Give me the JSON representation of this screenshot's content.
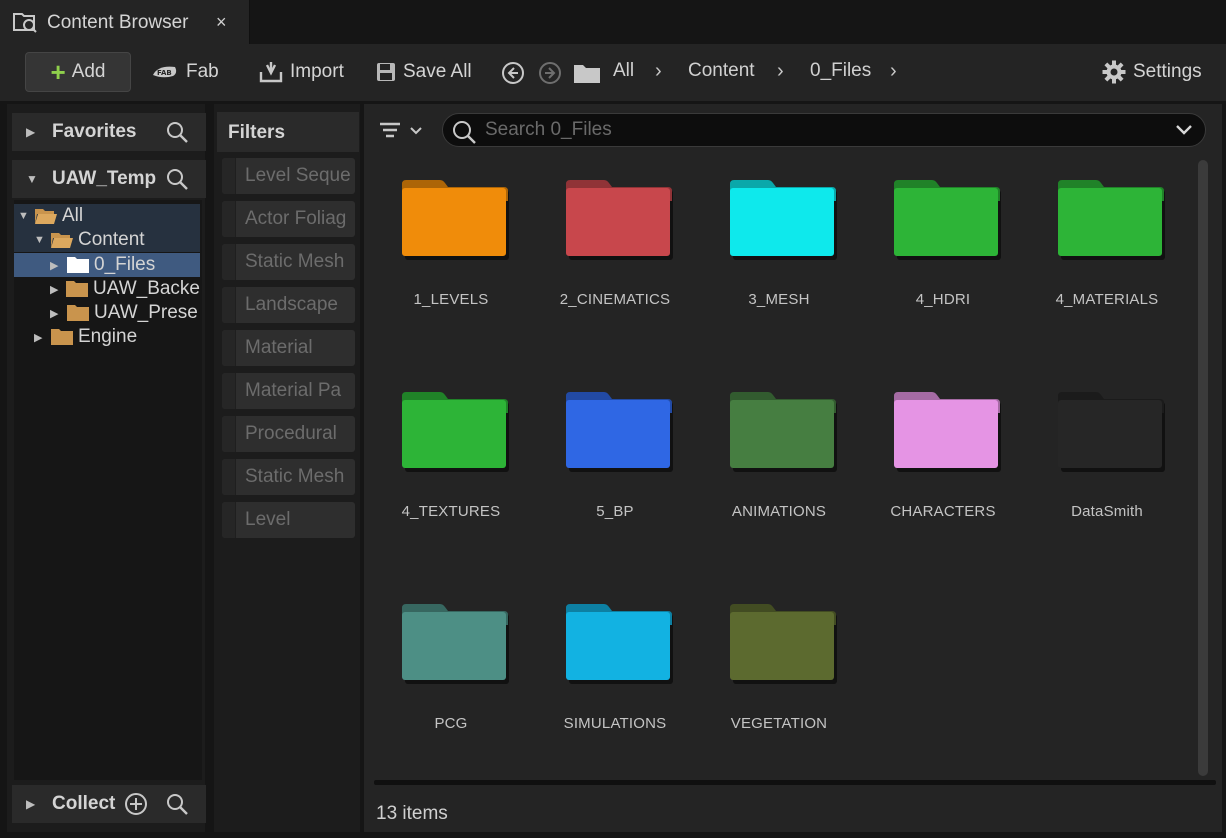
{
  "tab": {
    "title": "Content Browser",
    "close": "×"
  },
  "toolbar": {
    "add_label": "Add",
    "fab_label": "Fab",
    "import_label": "Import",
    "save_all_label": "Save All",
    "settings_label": "Settings"
  },
  "breadcrumbs": [
    "All",
    "Content",
    "0_Files"
  ],
  "left_panel": {
    "favorites_label": "Favorites",
    "project_label": "UAW_Temp",
    "collections_label": "Collect",
    "tree": [
      {
        "label": "All",
        "expanded": true
      },
      {
        "label": "Content",
        "expanded": true
      },
      {
        "label": "0_Files",
        "selected": true
      },
      {
        "label": "UAW_Backe"
      },
      {
        "label": "UAW_Prese"
      },
      {
        "label": "Engine"
      }
    ]
  },
  "filters": {
    "title": "Filters",
    "items": [
      "Level Seque",
      "Actor Foliag",
      "Static Mesh",
      "Landscape",
      "Material",
      "Material Pa",
      "Procedural",
      "Static Mesh",
      "Level"
    ]
  },
  "search": {
    "placeholder": "Search 0_Files",
    "value": ""
  },
  "folders": [
    {
      "name": "1_LEVELS",
      "color": "#f08c0a"
    },
    {
      "name": "2_CINEMATICS",
      "color": "#c8474c"
    },
    {
      "name": "3_MESH",
      "color": "#0ee9ec"
    },
    {
      "name": "4_HDRI",
      "color": "#2db437"
    },
    {
      "name": "4_MATERIALS",
      "color": "#2db437"
    },
    {
      "name": "4_TEXTURES",
      "color": "#2db437"
    },
    {
      "name": "5_BP",
      "color": "#2f67e4"
    },
    {
      "name": "ANIMATIONS",
      "color": "#467e41"
    },
    {
      "name": "CHARACTERS",
      "color": "#e594e4"
    },
    {
      "name": "DataSmith",
      "color": "#262626"
    },
    {
      "name": "PCG",
      "color": "#4d8f85"
    },
    {
      "name": "SIMULATIONS",
      "color": "#12b2e2"
    },
    {
      "name": "VEGETATION",
      "color": "#5c6a2f"
    }
  ],
  "status": {
    "items_count": "13 items"
  },
  "colors": {
    "accent_add": "#8fd04c",
    "selection": "#3f5a80",
    "tree_folder": "#c9944d"
  }
}
